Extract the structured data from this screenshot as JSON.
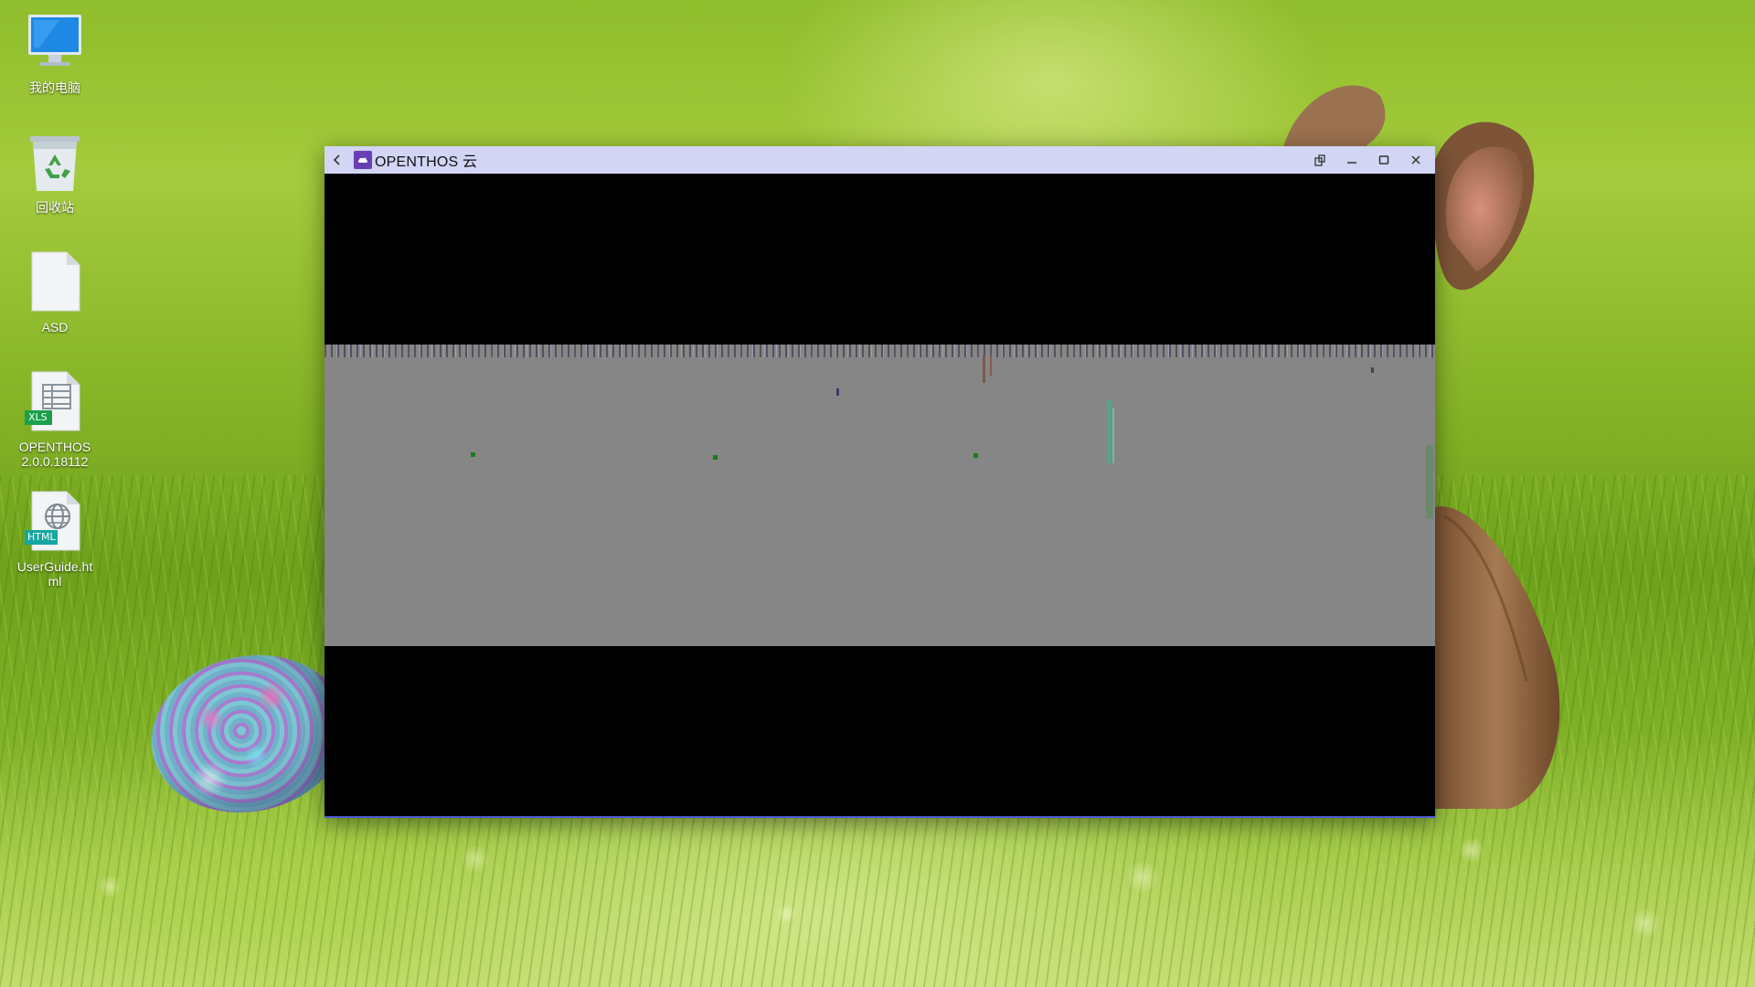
{
  "desktop": {
    "icons": [
      {
        "label": "我的电脑",
        "icon": "computer-icon"
      },
      {
        "label": "回收站",
        "icon": "recycle-bin-icon"
      },
      {
        "label": "ASD",
        "icon": "blank-file-icon"
      },
      {
        "label": "OPENTHOS 2.0.0.18112",
        "icon": "xls-file-icon",
        "badge": "XLS",
        "badge_color": "#1aa04a"
      },
      {
        "label": "UserGuide.html",
        "icon": "html-file-icon",
        "badge": "HTML",
        "badge_color": "#14a7a0"
      }
    ]
  },
  "window": {
    "title": "OPENTHOS 云",
    "titlebar_color": "#d2d5f3",
    "app_icon_color": "#6a3fb5",
    "buttons": {
      "back": "back-icon",
      "rotate": "rotate-icon",
      "minimize": "minimize-icon",
      "maximize": "maximize-icon",
      "close": "close-icon"
    }
  }
}
